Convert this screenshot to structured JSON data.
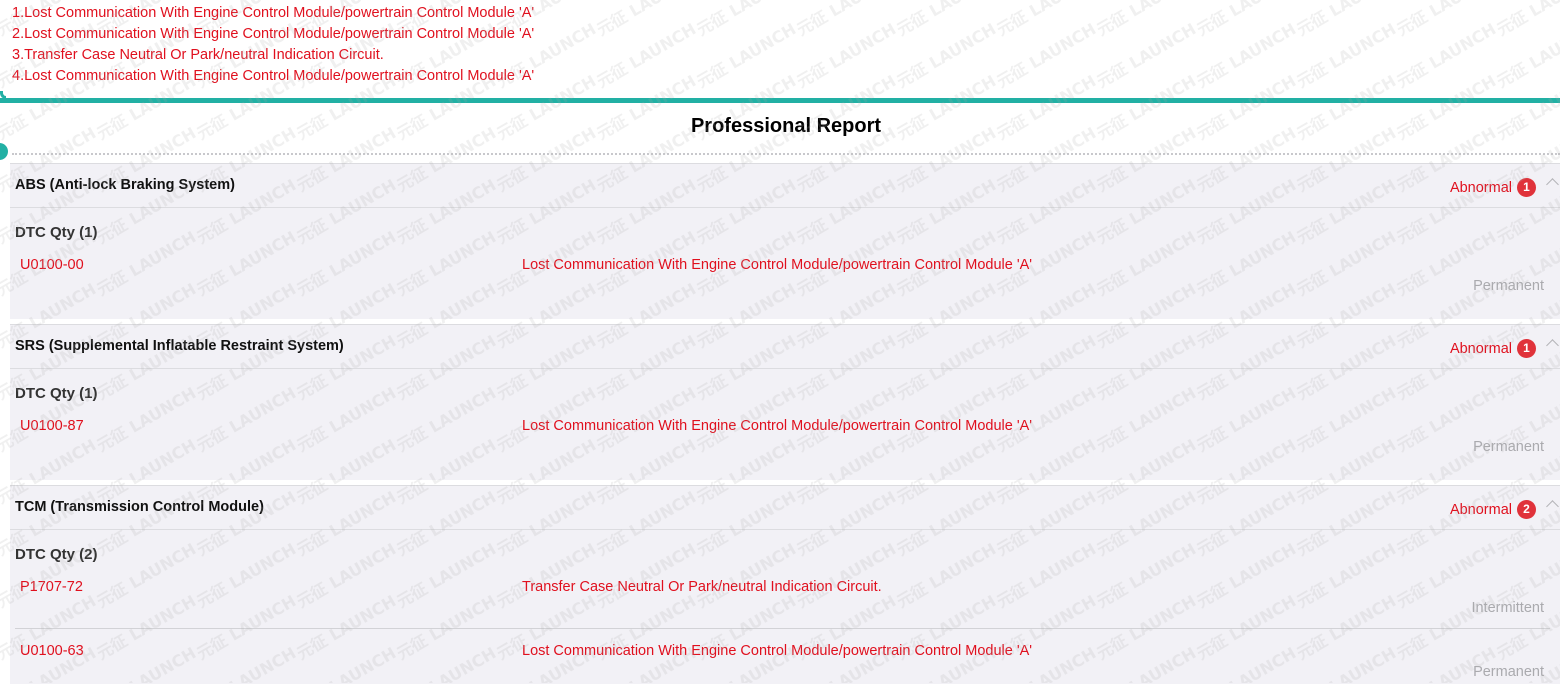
{
  "summary": {
    "lines": [
      "1.Lost Communication With Engine Control Module/powertrain Control Module 'A'",
      "2.Lost Communication With Engine Control Module/powertrain Control Module 'A'",
      "3.Transfer Case Neutral Or Park/neutral Indication Circuit.",
      "4.Lost Communication With Engine Control Module/powertrain Control Module 'A'"
    ]
  },
  "report": {
    "title": "Professional Report"
  },
  "watermark": "元征 LAUNCH",
  "colors": {
    "accent": "#22b0a4",
    "fault": "#e0101e",
    "badge": "#e0323a",
    "panel": "#f2f1f6"
  },
  "sections": [
    {
      "name": "ABS (Anti-lock Braking System)",
      "status": "Abnormal",
      "count": "1",
      "dtc_qty": "DTC Qty (1)",
      "dtcs": [
        {
          "code": "U0100-00",
          "description": "Lost Communication With Engine Control Module/powertrain Control Module 'A'",
          "type": "Permanent"
        }
      ]
    },
    {
      "name": "SRS (Supplemental Inflatable Restraint System)",
      "status": "Abnormal",
      "count": "1",
      "dtc_qty": "DTC Qty (1)",
      "dtcs": [
        {
          "code": "U0100-87",
          "description": "Lost Communication With Engine Control Module/powertrain Control Module 'A'",
          "type": "Permanent"
        }
      ]
    },
    {
      "name": "TCM (Transmission Control Module)",
      "status": "Abnormal",
      "count": "2",
      "dtc_qty": "DTC Qty (2)",
      "dtcs": [
        {
          "code": "P1707-72",
          "description": "Transfer Case Neutral Or Park/neutral Indication Circuit.",
          "type": "Intermittent"
        },
        {
          "code": "U0100-63",
          "description": "Lost Communication With Engine Control Module/powertrain Control Module 'A'",
          "type": "Permanent"
        }
      ]
    }
  ]
}
